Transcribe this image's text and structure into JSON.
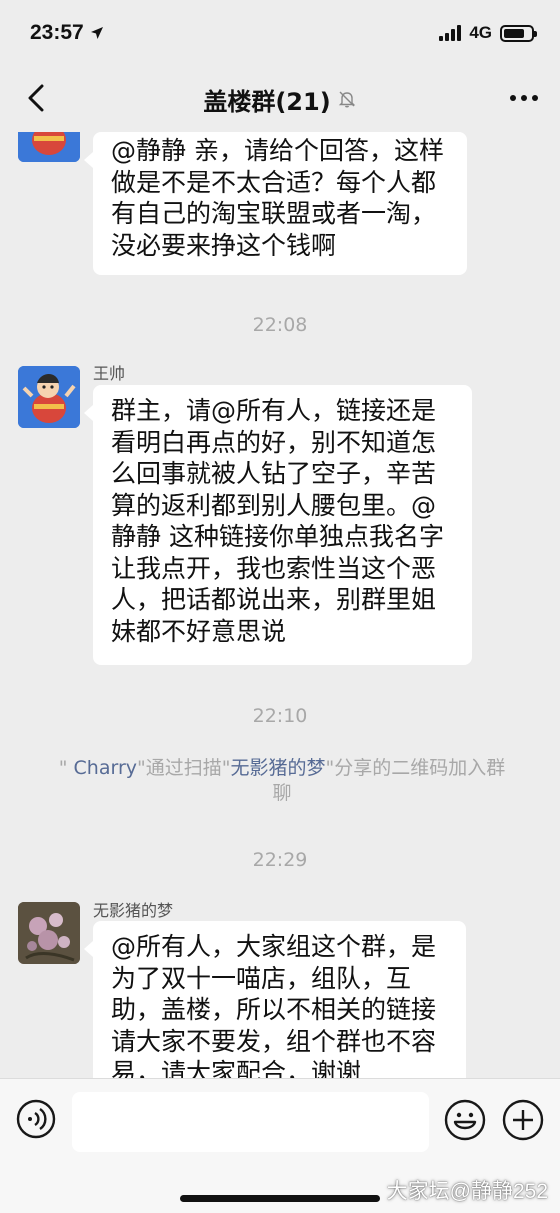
{
  "status_bar": {
    "time": "23:57",
    "network": "4G",
    "battery_level": 0.75
  },
  "nav": {
    "title": "盖楼群(21)",
    "icons": {
      "back": "chevron-left-icon",
      "mute": "bell-slash-icon",
      "more": "more-dots-icon"
    }
  },
  "messages": [
    {
      "sender": "",
      "text": "@静静 亲，请给个回答，这样做是不是不太合适？每个人都有自己的淘宝联盟或者一淘，没必要来挣这个钱啊"
    },
    {
      "timestamp": "22:08"
    },
    {
      "sender": "王帅",
      "text": "群主，请@所有人，链接还是看明白再点的好，别不知道怎么回事就被人钻了空子，辛苦算的返利都到别人腰包里。@静静 这种链接你单独点我名字让我点开，我也索性当这个恶人，把话都说出来，别群里姐妹都不好意思说"
    },
    {
      "timestamp": "22:10"
    },
    {
      "system": {
        "q1": "\"",
        "user": " Charry",
        "mid": "\"通过扫描\"",
        "inviter": "无影猪的梦",
        "tail": "\"分享的二维码加入群聊"
      }
    },
    {
      "timestamp": "22:29"
    },
    {
      "sender": "无影猪的梦",
      "text": "@所有人，大家组这个群，是为了双十一喵店，组队，互助，盖楼，所以不相关的链接请大家不要发，组个群也不容易，请大家配合，谢谢"
    }
  ],
  "colors": {
    "background": "#ededed",
    "bubble": "#ffffff",
    "link": "#576b95",
    "timestamp": "#a8a8a8"
  },
  "input_bar": {
    "text": "",
    "icons": {
      "voice": "voice-icon",
      "emoji": "emoji-icon",
      "add": "plus-circle-icon"
    }
  },
  "watermark": "大家坛@静静252"
}
